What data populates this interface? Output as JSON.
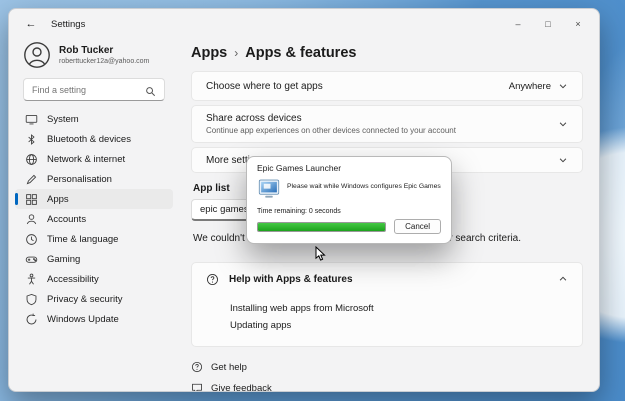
{
  "window": {
    "title": "Settings",
    "back": "←",
    "controls": {
      "minimize": "–",
      "maximize": "□",
      "close": "×"
    }
  },
  "user": {
    "name": "Rob Tucker",
    "email": "roberttucker12a@yahoo.com"
  },
  "search": {
    "placeholder": "Find a setting"
  },
  "sidebar": {
    "selected_index": 4,
    "items": [
      {
        "label": "System"
      },
      {
        "label": "Bluetooth & devices"
      },
      {
        "label": "Network & internet"
      },
      {
        "label": "Personalisation"
      },
      {
        "label": "Apps"
      },
      {
        "label": "Accounts"
      },
      {
        "label": "Time & language"
      },
      {
        "label": "Gaming"
      },
      {
        "label": "Accessibility"
      },
      {
        "label": "Privacy & security"
      },
      {
        "label": "Windows Update"
      }
    ]
  },
  "header": {
    "breadcrumb_root": "Apps",
    "separator": "›",
    "title": "Apps & features"
  },
  "main": {
    "choose_where": {
      "label": "Choose where to get apps",
      "value": "Anywhere"
    },
    "share_devices": {
      "label": "Share across devices",
      "description": "Continue app experiences on other devices connected to your account"
    },
    "more_settings": {
      "label": "More settings"
    },
    "app_list": {
      "label": "App list",
      "search_value": "epic games"
    },
    "empty_message": "We couldn't find anything to show here. Double check your search criteria.",
    "help": {
      "label": "Help with Apps & features",
      "links": [
        {
          "label": "Installing web apps from Microsoft"
        },
        {
          "label": "Updating apps"
        }
      ]
    },
    "footer_links": [
      {
        "label": "Get help"
      },
      {
        "label": "Give feedback"
      }
    ]
  },
  "dialog": {
    "title": "Epic Games Launcher",
    "message": "Please wait while Windows configures Epic Games Launcher",
    "time_remaining": "Time remaining: 0 seconds",
    "cancel_label": "Cancel",
    "progress_percent": 100
  },
  "colors": {
    "accent": "#0067c0",
    "progress_green": "#29b129"
  }
}
